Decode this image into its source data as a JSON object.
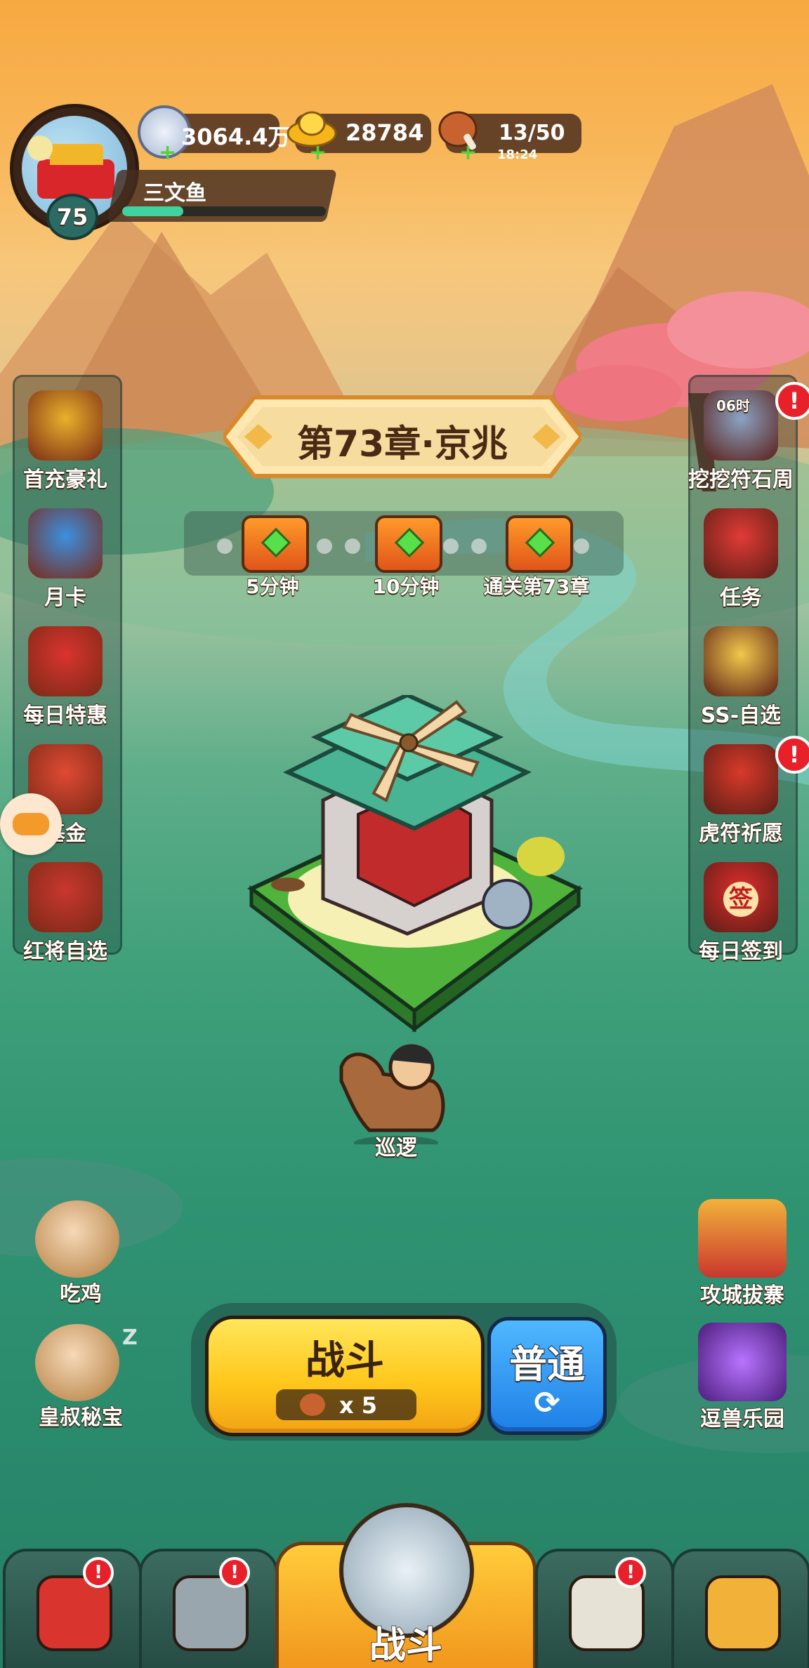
{
  "player": {
    "name": "三文鱼",
    "level": "75",
    "exp_fraction": 0.3
  },
  "resources": {
    "silver": {
      "value": "3064.4万",
      "icon": "silver-coin-icon"
    },
    "gold": {
      "value": "28784",
      "icon": "gold-ingot-icon"
    },
    "stamina": {
      "value": "13/50",
      "timer": "18:24",
      "icon": "meat-drumstick-icon"
    }
  },
  "chapter": {
    "title": "第73章·京兆"
  },
  "chests": [
    {
      "label": "5分钟"
    },
    {
      "label": "10分钟"
    },
    {
      "label": "通关第73章"
    }
  ],
  "left_menu": [
    {
      "label": "首充豪礼",
      "icon": "treasure-chest-icon"
    },
    {
      "label": "月卡",
      "icon": "month-card-icon"
    },
    {
      "label": "每日特惠",
      "icon": "gift-bag-icon"
    },
    {
      "label": "基金",
      "icon": "fund-character-icon"
    },
    {
      "label": "红将自选",
      "icon": "red-general-icon"
    }
  ],
  "right_menu": [
    {
      "label": "挖挖符石周",
      "icon": "rune-dig-icon",
      "timer": "06时",
      "alert": "!"
    },
    {
      "label": "任务",
      "icon": "task-scroll-icon"
    },
    {
      "label": "SS-自选",
      "icon": "ss-select-icon"
    },
    {
      "label": "虎符祈愿",
      "icon": "tiger-tally-icon",
      "alert": "!"
    },
    {
      "label": "每日签到",
      "icon": "daily-signin-icon",
      "stamp": "签"
    }
  ],
  "patrol": {
    "label": "巡逻"
  },
  "left_bottom": [
    {
      "label": "吃鸡",
      "icon": "chicken-character-icon"
    },
    {
      "label": "皇叔秘宝",
      "icon": "uncle-treasure-icon",
      "sleep": "Z"
    }
  ],
  "right_bottom": [
    {
      "label": "攻城拔寨",
      "icon": "siege-gate-icon"
    },
    {
      "label": "逗兽乐园",
      "icon": "beast-park-icon"
    }
  ],
  "battle": {
    "label": "战斗",
    "cost": "x 5"
  },
  "mode": {
    "label": "普通",
    "icon": "refresh-icon"
  },
  "bottom_nav": [
    {
      "name": "palace",
      "icon": "palace-icon",
      "alert": "!"
    },
    {
      "name": "equipment",
      "icon": "helmet-icon",
      "alert": "!"
    },
    {
      "name": "battle",
      "label": "战斗",
      "icon": "crossed-swords-icon"
    },
    {
      "name": "war-horn",
      "icon": "war-horn-icon",
      "alert": "!"
    },
    {
      "name": "upgrade",
      "icon": "fist-upgrade-icon"
    }
  ],
  "colors": {
    "gold_button": "#ffd21f",
    "blue_button": "#2f8ff0",
    "alert_red": "#e8202a",
    "exp_bar": "#3fd3a0"
  }
}
